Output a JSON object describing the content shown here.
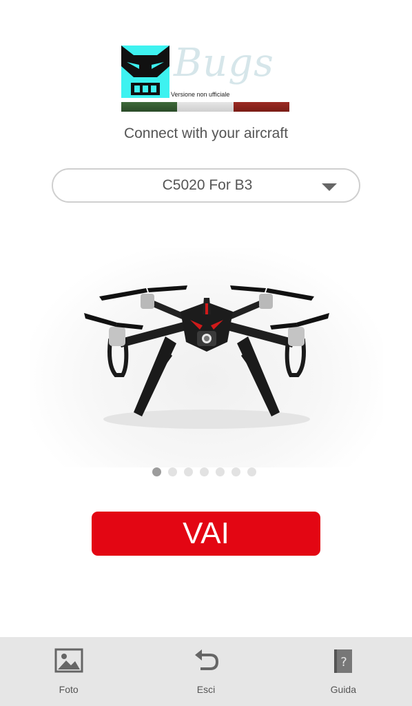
{
  "logo": {
    "wordmark": "Bugs",
    "tagline": "Versione non ufficiale",
    "mascot_color": "#3ef2f0"
  },
  "subtitle": "Connect with your aircraft",
  "aircraft_select": {
    "selected": "C5020 For B3"
  },
  "carousel": {
    "image": "drone-photo",
    "page_count": 7,
    "active_index": 0
  },
  "go_button": {
    "label": "VAI",
    "color": "#e30613"
  },
  "bottom_nav": {
    "items": [
      {
        "label": "Foto",
        "icon": "photo-icon"
      },
      {
        "label": "Esci",
        "icon": "undo-arrow-icon"
      },
      {
        "label": "Guida",
        "icon": "help-book-icon"
      }
    ]
  }
}
